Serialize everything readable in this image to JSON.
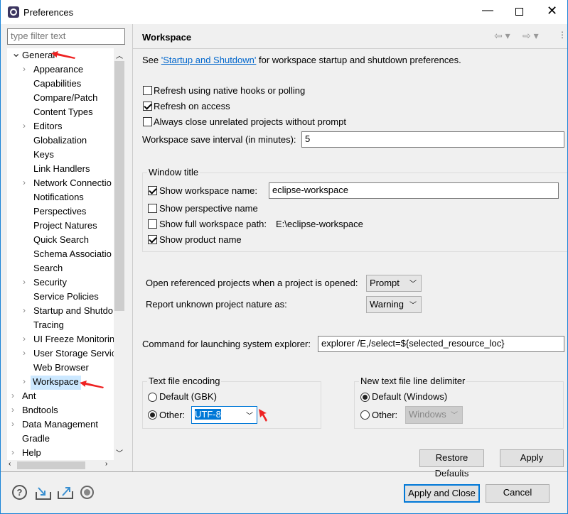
{
  "window": {
    "title": "Preferences",
    "icon": "eclipse-gear-icon"
  },
  "filter": {
    "placeholder": "type filter text"
  },
  "tree": [
    {
      "label": "General",
      "level": 0,
      "arrow": "expanded"
    },
    {
      "label": "Appearance",
      "level": 1,
      "arrow": "collapsed"
    },
    {
      "label": "Capabilities",
      "level": 1
    },
    {
      "label": "Compare/Patch",
      "level": 1
    },
    {
      "label": "Content Types",
      "level": 1
    },
    {
      "label": "Editors",
      "level": 1,
      "arrow": "collapsed"
    },
    {
      "label": "Globalization",
      "level": 1
    },
    {
      "label": "Keys",
      "level": 1
    },
    {
      "label": "Link Handlers",
      "level": 1
    },
    {
      "label": "Network Connectio",
      "level": 1,
      "arrow": "collapsed"
    },
    {
      "label": "Notifications",
      "level": 1
    },
    {
      "label": "Perspectives",
      "level": 1
    },
    {
      "label": "Project Natures",
      "level": 1
    },
    {
      "label": "Quick Search",
      "level": 1
    },
    {
      "label": "Schema Associatio",
      "level": 1
    },
    {
      "label": "Search",
      "level": 1
    },
    {
      "label": "Security",
      "level": 1,
      "arrow": "collapsed"
    },
    {
      "label": "Service Policies",
      "level": 1
    },
    {
      "label": "Startup and Shutdo",
      "level": 1,
      "arrow": "collapsed"
    },
    {
      "label": "Tracing",
      "level": 1
    },
    {
      "label": "UI Freeze Monitorin",
      "level": 1,
      "arrow": "collapsed"
    },
    {
      "label": "User Storage Servic",
      "level": 1,
      "arrow": "collapsed"
    },
    {
      "label": "Web Browser",
      "level": 1
    },
    {
      "label": "Workspace",
      "level": 1,
      "arrow": "collapsed",
      "selected": true
    },
    {
      "label": "Ant",
      "level": 0,
      "arrow": "collapsed"
    },
    {
      "label": "Bndtools",
      "level": 0,
      "arrow": "collapsed"
    },
    {
      "label": "Data Management",
      "level": 0,
      "arrow": "collapsed"
    },
    {
      "label": "Gradle",
      "level": 0
    },
    {
      "label": "Help",
      "level": 0,
      "arrow": "collapsed"
    }
  ],
  "page": {
    "title": "Workspace",
    "see_prefix": "See ",
    "see_link": "'Startup and Shutdown'",
    "see_suffix": " for workspace startup and shutdown preferences.",
    "refresh_native": {
      "label": "Refresh using native hooks or polling",
      "checked": false
    },
    "refresh_access": {
      "label": "Refresh on access",
      "checked": true
    },
    "always_close": {
      "label": "Always close unrelated projects without prompt",
      "checked": false
    },
    "save_interval": {
      "label": "Workspace save interval (in minutes):",
      "value": "5"
    },
    "window_title": {
      "title": "Window title",
      "show_ws_name": {
        "label": "Show workspace name:",
        "checked": true,
        "value": "eclipse-workspace"
      },
      "show_persp": {
        "label": "Show perspective name",
        "checked": false
      },
      "show_path": {
        "label": "Show full workspace path:",
        "checked": false,
        "value": "E:\\eclipse-workspace"
      },
      "show_product": {
        "label": "Show product name",
        "checked": true
      }
    },
    "open_ref": {
      "label": "Open referenced projects when a project is opened:",
      "value": "Prompt"
    },
    "report_unknown": {
      "label": "Report unknown project nature as:",
      "value": "Warning"
    },
    "explorer": {
      "label": "Command for launching system explorer:",
      "value": "explorer /E,/select=${selected_resource_loc}"
    },
    "encoding": {
      "title": "Text file encoding",
      "default_label": "Default (GBK)",
      "other_label": "Other:",
      "selected": "other",
      "value": "UTF-8"
    },
    "delimiter": {
      "title": "New text file line delimiter",
      "default_label": "Default (Windows)",
      "other_label": "Other:",
      "selected": "default",
      "value": "Windows"
    },
    "restore_defaults": "Restore Defaults",
    "apply": "Apply"
  },
  "footer": {
    "apply_close": "Apply and Close",
    "cancel": "Cancel",
    "icons": [
      "help-icon",
      "import-icon",
      "export-icon",
      "record-icon"
    ]
  },
  "colors": {
    "link": "#0066cc",
    "selection": "#cce8ff",
    "annotation_arrow": "#ee2222",
    "focus": "#0078d7"
  }
}
